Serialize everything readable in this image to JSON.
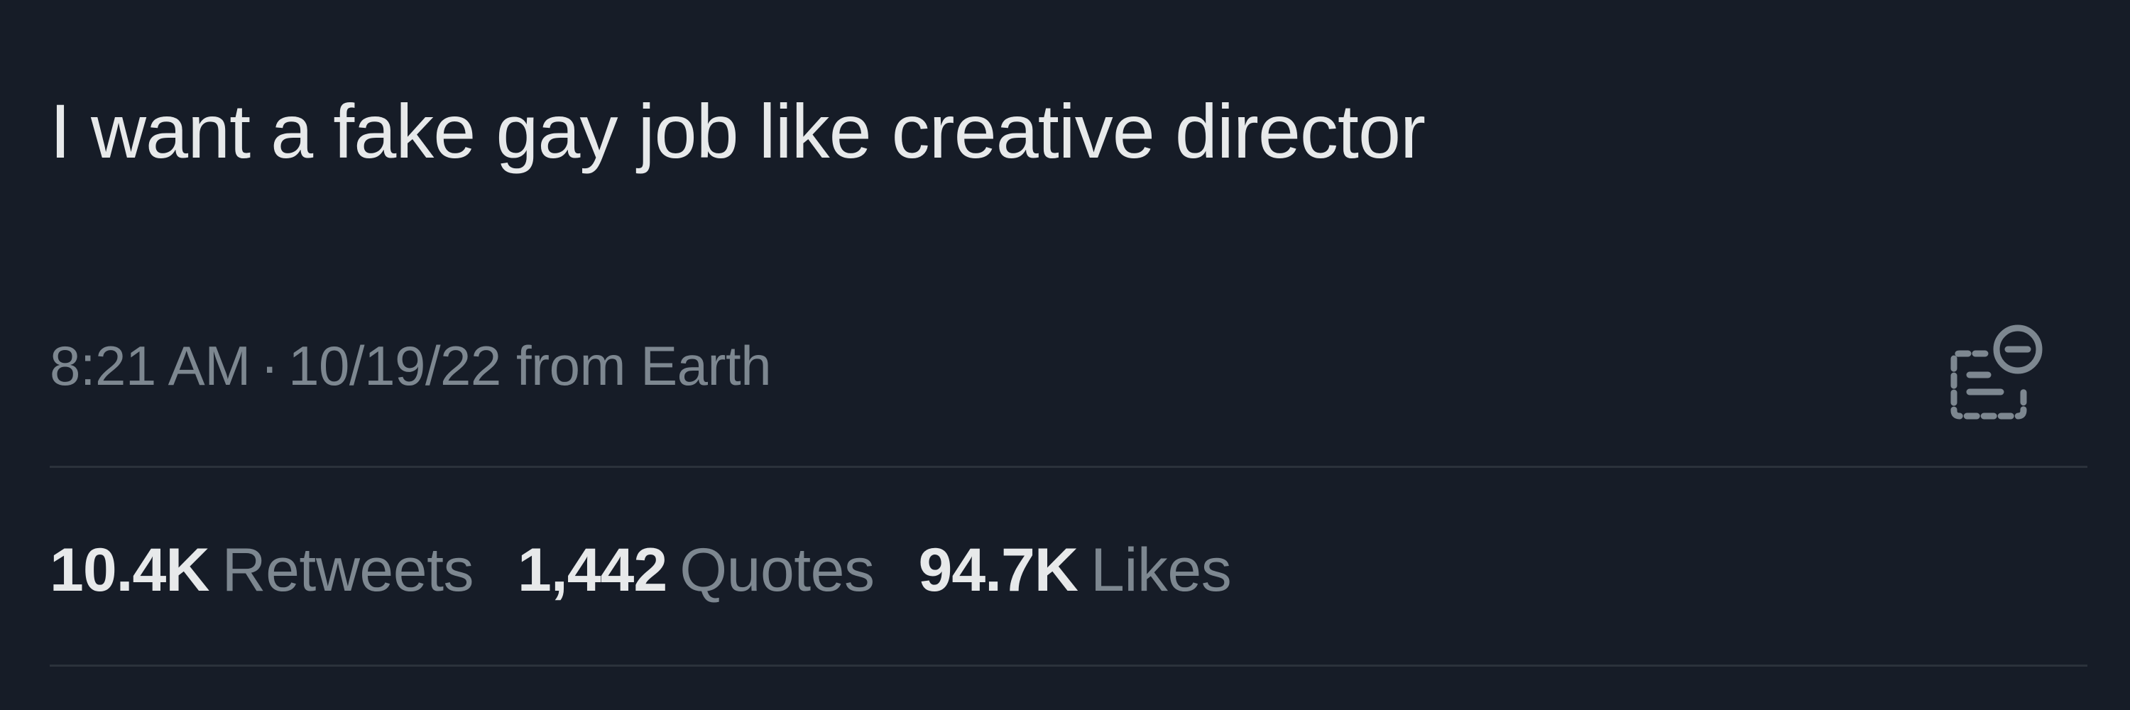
{
  "tweet": {
    "text": "I want a fake gay job like creative director",
    "time": "8:21 AM",
    "separator": "·",
    "date": "10/19/22",
    "source": "from Earth",
    "analytics_icon": "analytics-icon"
  },
  "stats": [
    {
      "count": "10.4K",
      "label": "Retweets"
    },
    {
      "count": "1,442",
      "label": "Quotes"
    },
    {
      "count": "94.7K",
      "label": "Likes"
    }
  ],
  "colors": {
    "background": "#161c27",
    "primary_text": "#e7e9ea",
    "secondary_text": "#7d8790",
    "divider": "#2b323b"
  }
}
